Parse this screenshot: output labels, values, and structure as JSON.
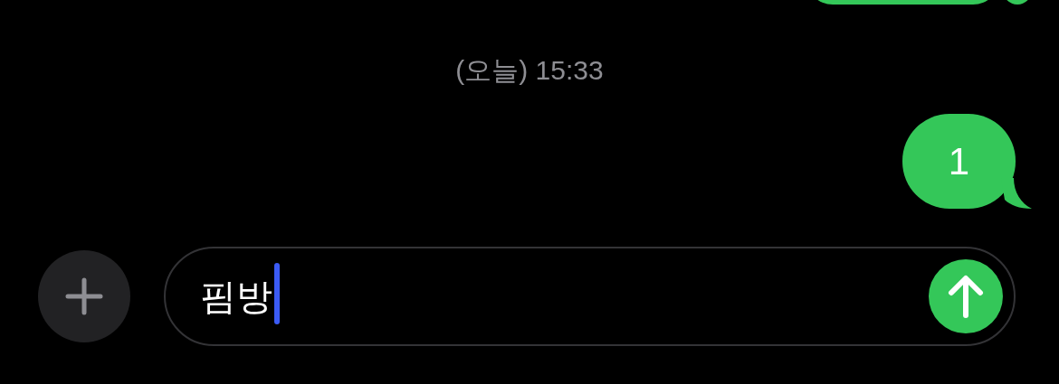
{
  "timestamp": "(오늘) 15:33",
  "messages": [
    {
      "text": "1",
      "outgoing": true
    }
  ],
  "composer": {
    "value": "핌방",
    "caret": true
  }
}
